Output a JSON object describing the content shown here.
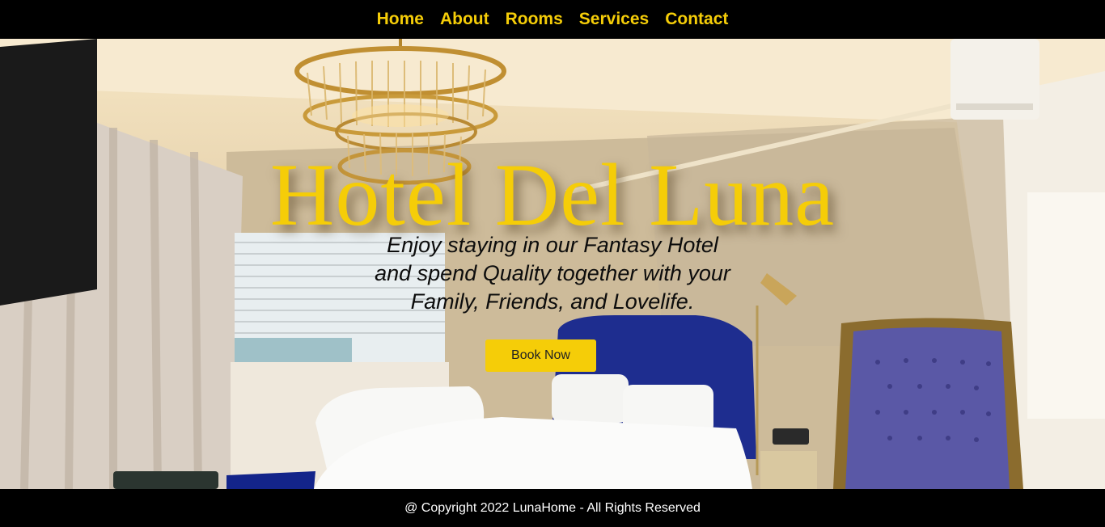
{
  "nav": {
    "items": [
      {
        "label": "Home"
      },
      {
        "label": "About"
      },
      {
        "label": "Rooms"
      },
      {
        "label": "Services"
      },
      {
        "label": "Contact"
      }
    ]
  },
  "hero": {
    "title": "Hotel Del Luna",
    "subtitle_lines": [
      "Enjoy staying in our Fantasy Hotel",
      "and spend Quality together with your",
      "Family, Friends, and Lovelife."
    ],
    "button_label": "Book Now"
  },
  "footer": {
    "text": "@ Copyright 2022 LunaHome - All Rights Reserved"
  },
  "colors": {
    "accent": "#f5cd08",
    "nav_background": "#000000",
    "footer_text": "#ffffff"
  }
}
